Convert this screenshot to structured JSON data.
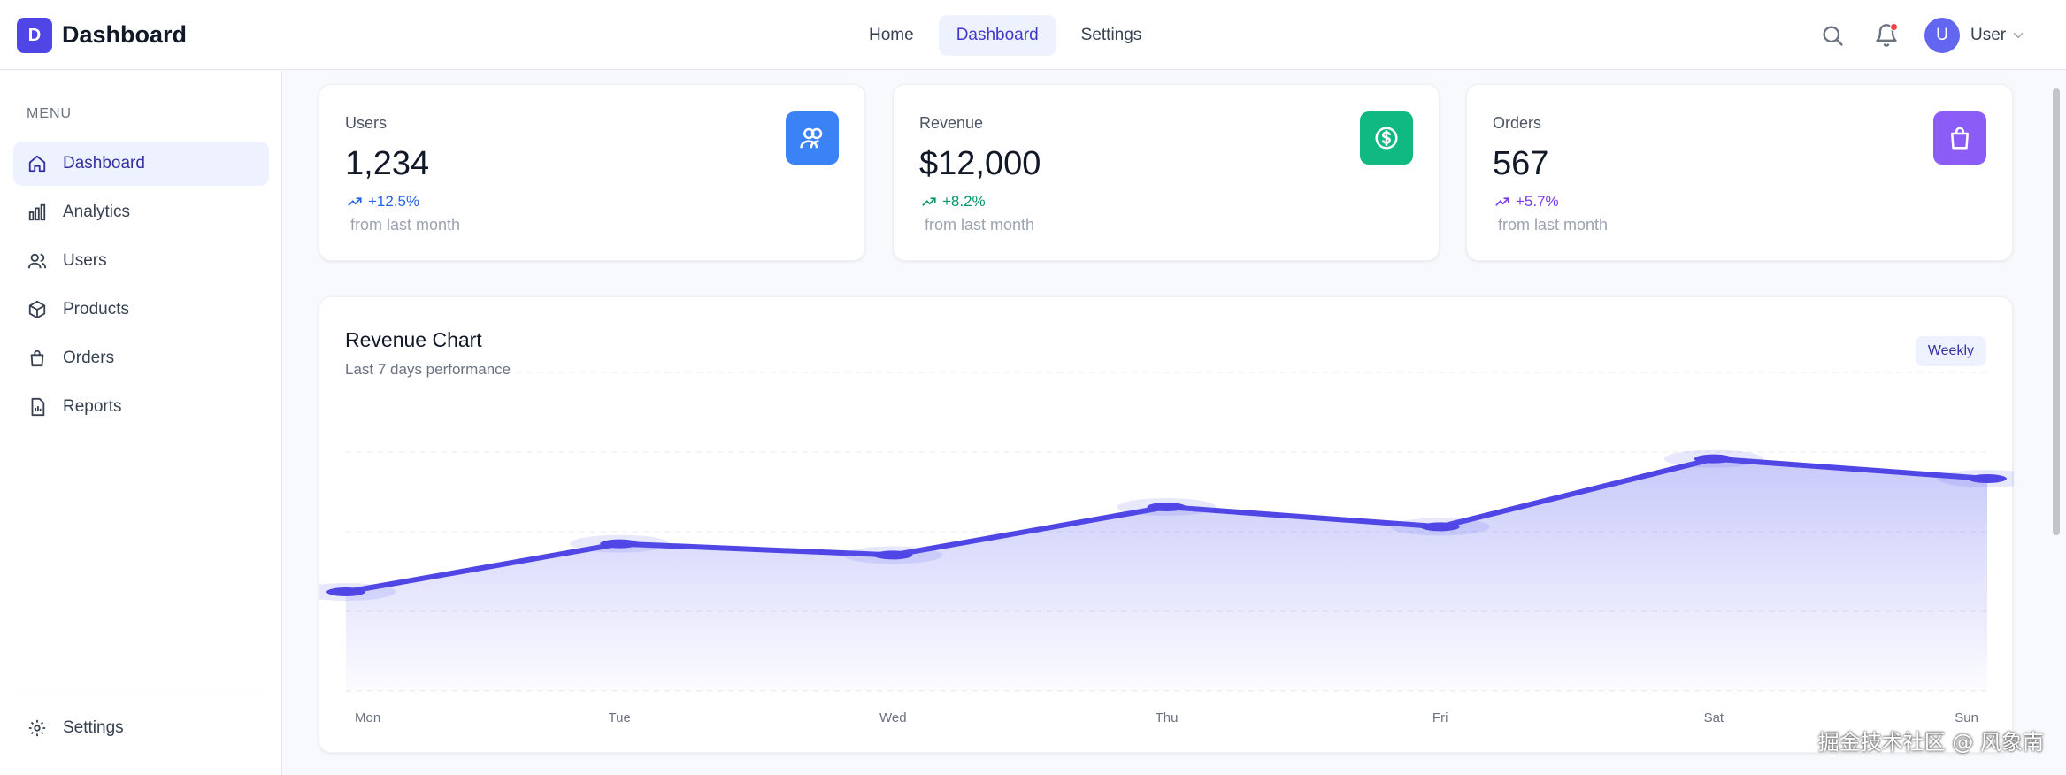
{
  "header": {
    "logo_letter": "D",
    "brand": "Dashboard",
    "nav": [
      {
        "label": "Home",
        "active": false
      },
      {
        "label": "Dashboard",
        "active": true
      },
      {
        "label": "Settings",
        "active": false
      }
    ],
    "user": {
      "initial": "U",
      "name": "User"
    },
    "icons": [
      "search-icon",
      "bell-icon",
      "chevron-down-icon"
    ]
  },
  "sidebar": {
    "menu_label": "MENU",
    "items": [
      {
        "label": "Dashboard",
        "icon": "home-icon",
        "active": true
      },
      {
        "label": "Analytics",
        "icon": "bar-chart-icon",
        "active": false
      },
      {
        "label": "Users",
        "icon": "users-icon",
        "active": false
      },
      {
        "label": "Products",
        "icon": "box-icon",
        "active": false
      },
      {
        "label": "Orders",
        "icon": "bag-icon",
        "active": false
      },
      {
        "label": "Reports",
        "icon": "report-icon",
        "active": false
      }
    ],
    "settings": {
      "label": "Settings",
      "icon": "gear-icon"
    }
  },
  "stats": [
    {
      "label": "Users",
      "value": "1,234",
      "change": "+12.5%",
      "sub": "from last month",
      "color": "#3b82f6",
      "change_color": "#2563eb",
      "icon": "users-icon"
    },
    {
      "label": "Revenue",
      "value": "$12,000",
      "change": "+8.2%",
      "sub": "from last month",
      "color": "#10b981",
      "change_color": "#059669",
      "icon": "dollar-icon"
    },
    {
      "label": "Orders",
      "value": "567",
      "change": "+5.7%",
      "sub": "from last month",
      "color": "#8b5cf6",
      "change_color": "#7c3aed",
      "icon": "bag-icon"
    }
  ],
  "chart": {
    "title": "Revenue Chart",
    "subtitle": "Last 7 days performance",
    "period": "Weekly"
  },
  "chart_data": {
    "type": "area",
    "categories": [
      "Mon",
      "Tue",
      "Wed",
      "Thu",
      "Fri",
      "Sat",
      "Sun"
    ],
    "values": [
      35,
      52,
      48,
      65,
      58,
      82,
      75
    ],
    "ylim": [
      0,
      100
    ],
    "grid": true,
    "color": "#4f46e5"
  },
  "watermark": "掘金技术社区 @ 风象南"
}
